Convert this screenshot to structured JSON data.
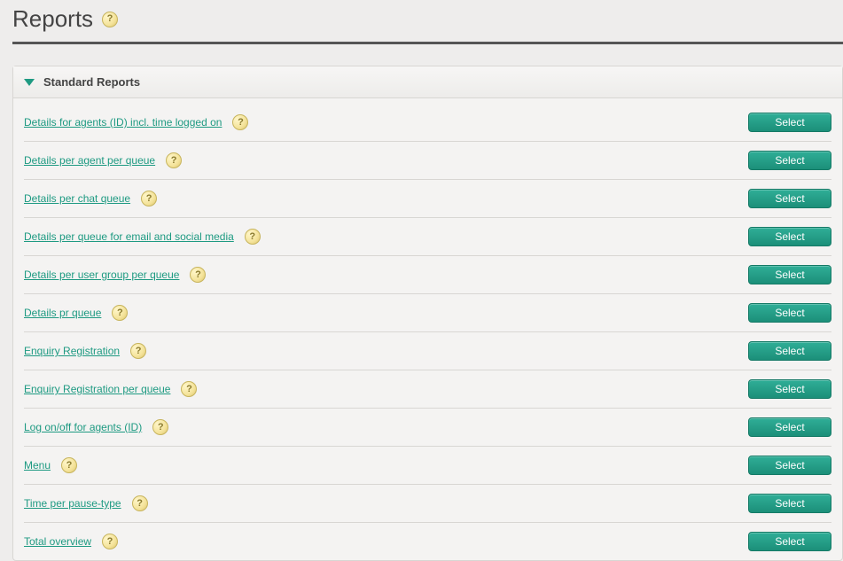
{
  "page": {
    "title": "Reports"
  },
  "panel": {
    "title": "Standard Reports"
  },
  "buttons": {
    "select_label": "Select"
  },
  "reports": [
    {
      "label": "Details for agents (ID) incl. time logged on"
    },
    {
      "label": "Details per agent per queue"
    },
    {
      "label": "Details per chat queue"
    },
    {
      "label": "Details per queue for email and social media"
    },
    {
      "label": "Details per user group per queue"
    },
    {
      "label": "Details pr queue"
    },
    {
      "label": "Enquiry Registration"
    },
    {
      "label": "Enquiry Registration per queue"
    },
    {
      "label": "Log on/off for agents (ID)"
    },
    {
      "label": "Menu"
    },
    {
      "label": "Time per pause-type"
    },
    {
      "label": "Total overview"
    }
  ]
}
